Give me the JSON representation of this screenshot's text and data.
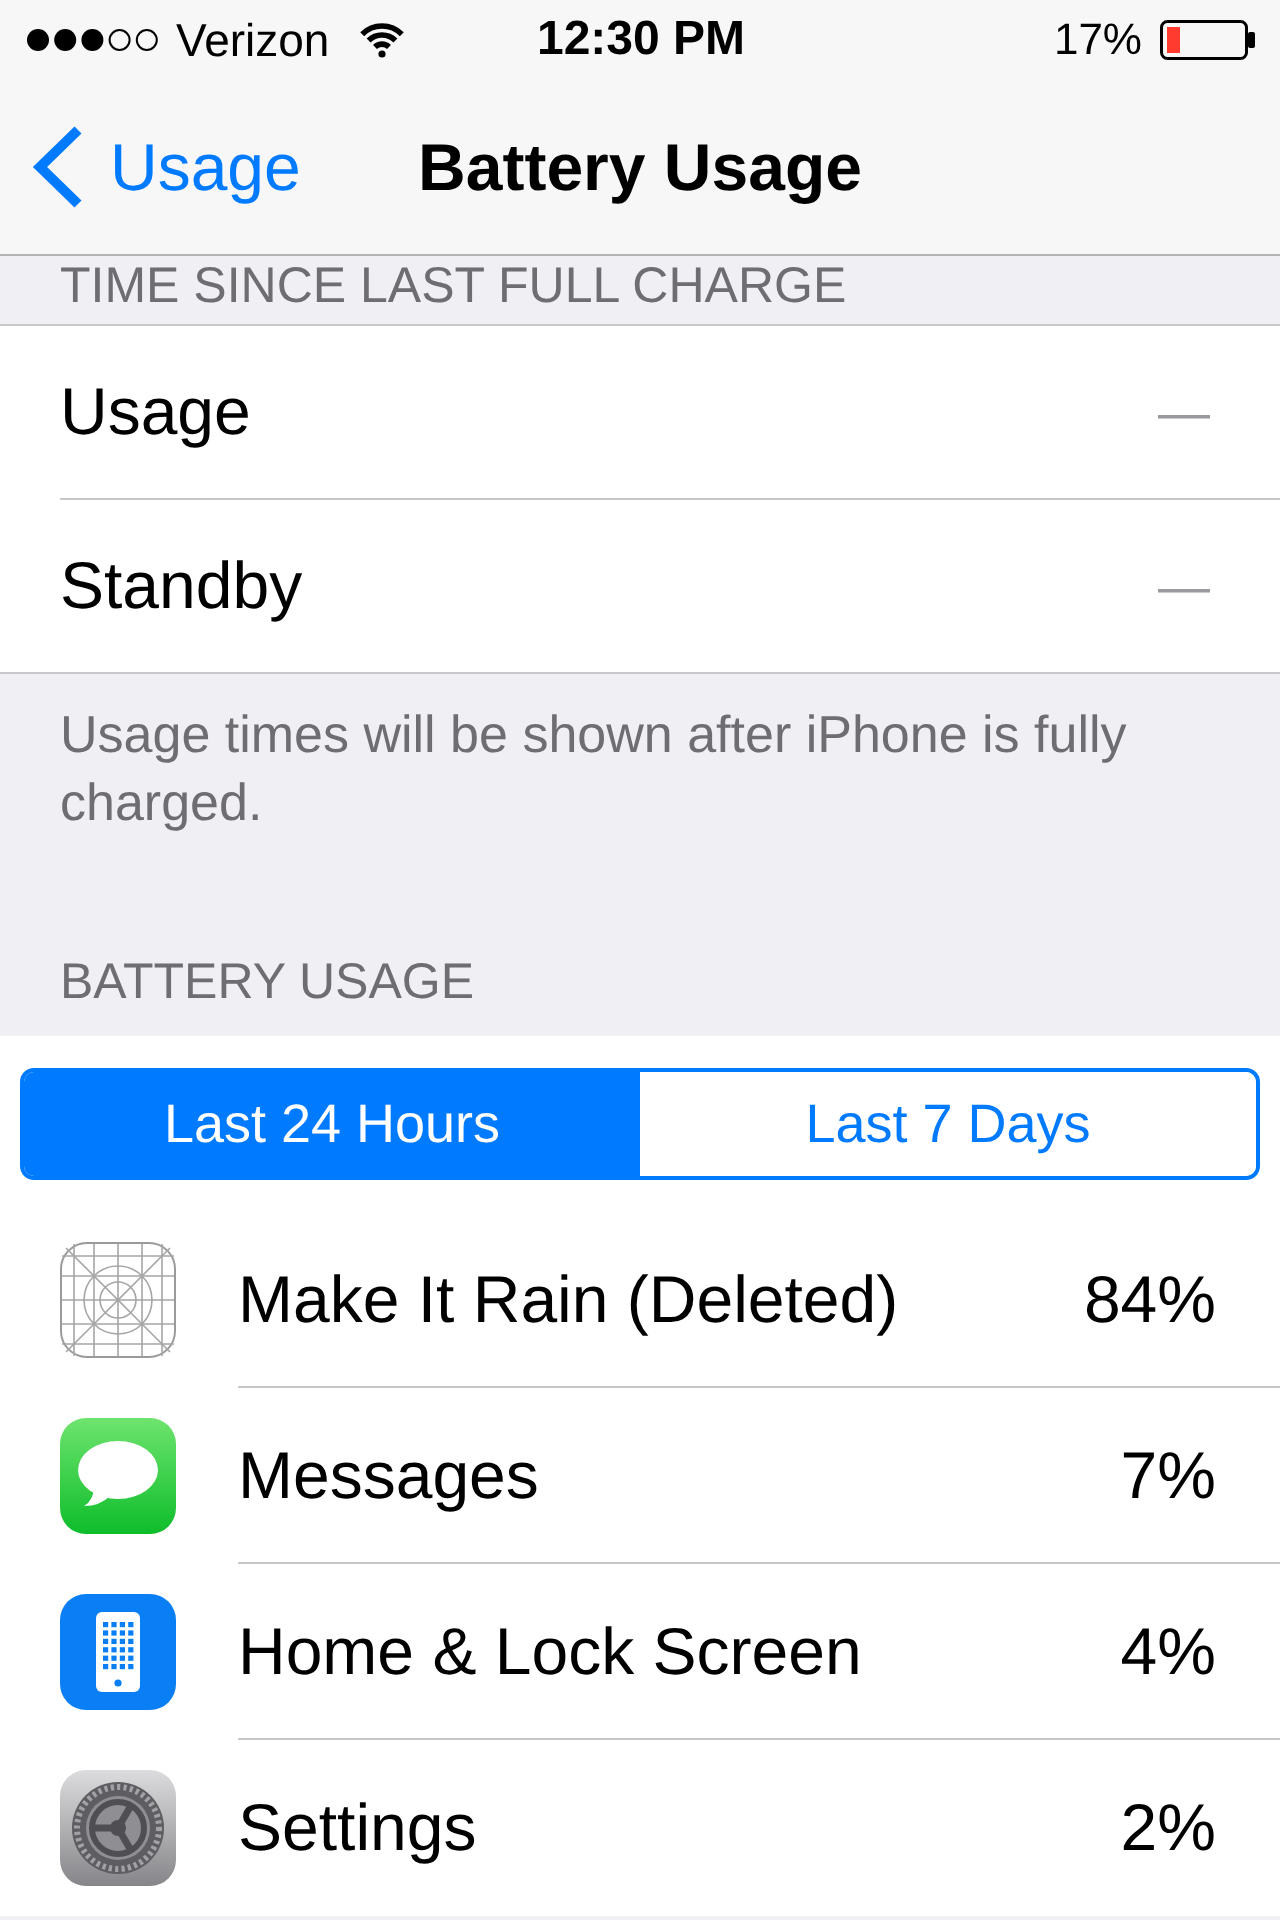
{
  "status_bar": {
    "carrier": "Verizon",
    "time": "12:30 PM",
    "battery": "17%"
  },
  "nav_bar": {
    "back": "Usage",
    "title": "Battery Usage"
  },
  "time_section": {
    "header": "TIME SINCE LAST FULL CHARGE",
    "rows": [
      {
        "label": "Usage",
        "value": "—"
      },
      {
        "label": "Standby",
        "value": "—"
      }
    ],
    "footer": "Usage times will be shown after iPhone is fully charged."
  },
  "battery_section": {
    "header": "BATTERY USAGE",
    "segments": [
      {
        "label": "Last 24 Hours",
        "selected": true
      },
      {
        "label": "Last 7 Days",
        "selected": false
      }
    ],
    "apps": [
      {
        "kind": "placeholder",
        "name": "Make It Rain (Deleted)",
        "percent": "84%"
      },
      {
        "kind": "messages",
        "name": "Messages",
        "percent": "7%"
      },
      {
        "kind": "device",
        "name": "Home & Lock Screen",
        "percent": "4%"
      },
      {
        "kind": "settings",
        "name": "Settings",
        "percent": "2%"
      }
    ]
  }
}
